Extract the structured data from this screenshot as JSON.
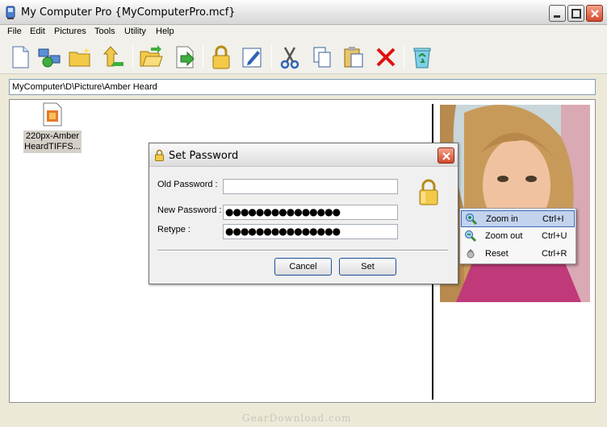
{
  "window": {
    "title": "My Computer Pro {MyComputerPro.mcf}"
  },
  "menu": {
    "items": [
      "File",
      "Edit",
      "Pictures",
      "Tools",
      "Utility",
      "Help"
    ]
  },
  "toolbar": {
    "icons": [
      "new-file-icon",
      "network-icon",
      "new-folder-icon",
      "go-up-icon",
      "open-folder-icon",
      "export-icon",
      "lock-icon",
      "edit-icon",
      "cut-icon",
      "copy-icon",
      "paste-icon",
      "delete-icon",
      "recycle-bin-icon"
    ]
  },
  "address": {
    "path": "MyComputer\\D\\Picture\\Amber Heard"
  },
  "file": {
    "label_line1": "220px-Amber",
    "label_line2": "HeardTIFFS..."
  },
  "context_menu": {
    "items": [
      {
        "label": "Zoom in",
        "shortcut": "Ctrl+I",
        "icon": "zoom-in-icon"
      },
      {
        "label": "Zoom out",
        "shortcut": "Ctrl+U",
        "icon": "zoom-out-icon"
      },
      {
        "label": "Reset",
        "shortcut": "Ctrl+R",
        "icon": "reset-icon"
      }
    ]
  },
  "dialog": {
    "title": "Set Password",
    "old_password_label": "Old Password :",
    "old_password_value": "",
    "new_password_label": "New Password :",
    "new_password_value": "●●●●●●●●●●●●●●●",
    "retype_label": "Retype :",
    "retype_value": "●●●●●●●●●●●●●●●",
    "cancel_label": "Cancel",
    "set_label": "Set"
  },
  "watermark": {
    "text": "GearDownload.com"
  }
}
